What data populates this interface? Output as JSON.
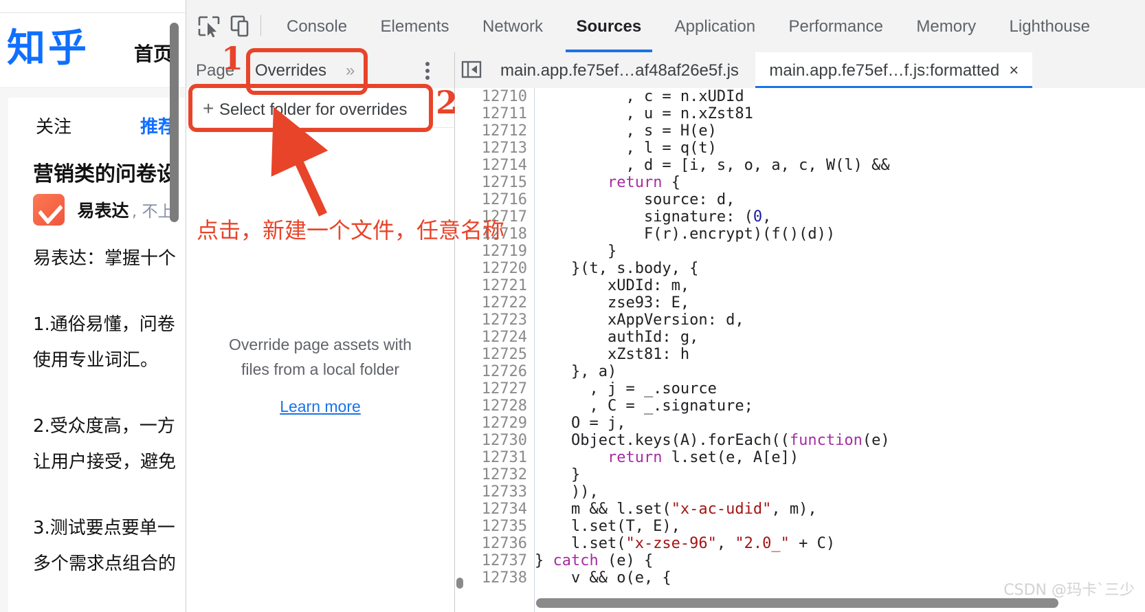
{
  "zhihu": {
    "logo": "知乎",
    "nav_home": "首页",
    "tabs": [
      {
        "label": "关注",
        "active": false
      },
      {
        "label": "推荐",
        "active": true
      }
    ],
    "feed": {
      "title": "营销类的问卷设",
      "author": "易表达",
      "author_sub": ", 不上",
      "paragraphs": [
        "易表达：掌握十个",
        "1.通俗易懂，问卷",
        "使用专业词汇。",
        "2.受众度高，一方",
        "让用户接受，避免",
        "3.测试要点要单一",
        "多个需求点组合的"
      ]
    },
    "colors": {
      "brand": "#0f6fff",
      "avatar": "#f1553b"
    }
  },
  "devtools": {
    "toolbar_icons": [
      {
        "name": "inspect-element-icon"
      },
      {
        "name": "device-toolbar-icon"
      }
    ],
    "tabs": [
      {
        "label": "Console",
        "active": false
      },
      {
        "label": "Elements",
        "active": false
      },
      {
        "label": "Network",
        "active": false
      },
      {
        "label": "Sources",
        "active": true
      },
      {
        "label": "Application",
        "active": false
      },
      {
        "label": "Performance",
        "active": false
      },
      {
        "label": "Memory",
        "active": false
      },
      {
        "label": "Lighthouse",
        "active": false
      }
    ],
    "navigator": {
      "tabs": [
        {
          "label": "Page",
          "active": false
        },
        {
          "label": "Overrides",
          "active": true
        }
      ],
      "more_label": "»",
      "select_folder_label": "Select folder for overrides",
      "plus_glyph": "+",
      "blurb_line1": "Override page assets with",
      "blurb_line2": "files from a local folder",
      "learn_more": "Learn more"
    },
    "editor": {
      "tabs": [
        {
          "label": "main.app.fe75ef…af48af26e5f.js",
          "active": false,
          "closable": false
        },
        {
          "label": "main.app.fe75ef…f.js:formatted",
          "active": true,
          "closable": true,
          "close_glyph": "×"
        }
      ],
      "first_line_number": 12710,
      "line_numbers": [
        "12710",
        "12711",
        "12712",
        "12713",
        "12714",
        "12715",
        "12716",
        "12717",
        "12718",
        "12719",
        "12720",
        "12721",
        "12722",
        "12723",
        "12724",
        "12725",
        "12726",
        "12727",
        "12728",
        "12729",
        "12730",
        "12731",
        "12732",
        "12733",
        "12734",
        "12735",
        "12736",
        "12737",
        "12738"
      ],
      "lines": [
        "          , c = n.xUDId",
        "          , u = n.xZst81",
        "          , s = H(e)",
        "          , l = q(t)",
        "          , d = [i, s, o, a, c, W(l) &&",
        "        return {",
        "            source: d,",
        "            signature: (0,",
        "            F(r).encrypt)(f()(d))",
        "        }",
        "    }(t, s.body, {",
        "        xUDId: m,",
        "        zse93: E,",
        "        xAppVersion: d,",
        "        authId: g,",
        "        xZst81: h",
        "    }, a)",
        "      , j = _.source",
        "      , C = _.signature;",
        "    O = j,",
        "    Object.keys(A).forEach((function(e)",
        "        return l.set(e, A[e])",
        "    }",
        "    )),",
        "    m && l.set(\"x-ac-udid\", m),",
        "    l.set(T, E),",
        "    l.set(\"x-zse-96\", \"2.0_\" + C)",
        "} catch (e) {",
        "    v && o(e, {"
      ],
      "colors": {
        "keyword": "#a42ea2",
        "string": "#a31515",
        "number": "#1a1aa6",
        "accent": "#1a73e8"
      }
    }
  },
  "annotations": {
    "color": "#e8442a",
    "marker_1": "1",
    "marker_2": "2",
    "note": "点击，新建一个文件，任意名称"
  },
  "watermark": "CSDN @玛卡`三少"
}
